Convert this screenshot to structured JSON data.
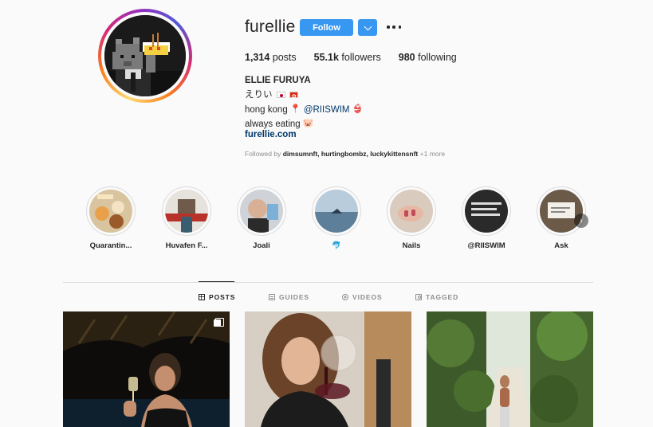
{
  "profile": {
    "username": "furellie",
    "follow_label": "Follow",
    "dropdown_icon": "chevron-down-icon",
    "more_icon": "more-options-icon",
    "stats": {
      "posts_count": "1,314",
      "posts_label": "posts",
      "followers_count": "55.1k",
      "followers_label": "followers",
      "following_count": "980",
      "following_label": "following"
    },
    "full_name": "ELLIE FURUYA",
    "bio": {
      "line1": "えりい",
      "line2_text": "hong kong",
      "line2_mention": "@RIISWIM",
      "line3": "always eating",
      "website": "furellie.com"
    },
    "followed_by": {
      "prefix": "Followed by",
      "names": "dimsumnft, hurtingbombz, luckykittensnft",
      "more": "+1 more"
    }
  },
  "highlights": [
    {
      "label": "Quarantin..."
    },
    {
      "label": "Huvafen F..."
    },
    {
      "label": "Joali"
    },
    {
      "label": "🐬"
    },
    {
      "label": "Nails"
    },
    {
      "label": "@RIISWIM"
    },
    {
      "label": "Ask"
    }
  ],
  "tabs": [
    {
      "label": "POSTS",
      "icon": "grid-icon",
      "active": true
    },
    {
      "label": "GUIDES",
      "icon": "guide-icon",
      "active": false
    },
    {
      "label": "VIDEOS",
      "icon": "video-icon",
      "active": false
    },
    {
      "label": "TAGGED",
      "icon": "tag-icon",
      "active": false
    }
  ],
  "colors": {
    "accent": "#3897f0",
    "link": "#00376b",
    "text": "#262626",
    "muted": "#8e8e8e",
    "border": "#dbdbdb"
  }
}
